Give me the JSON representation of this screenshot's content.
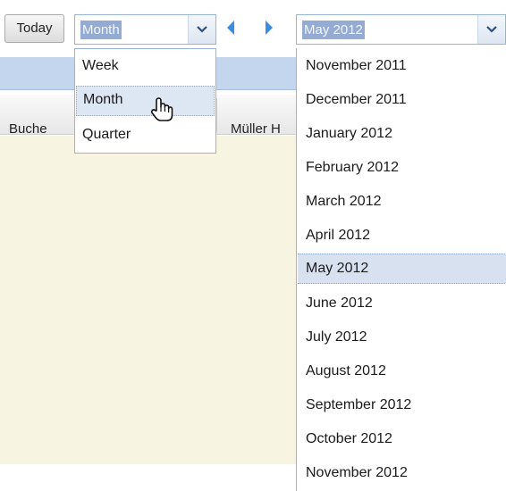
{
  "toolbar": {
    "today_label": "Today",
    "view_select_value": "Month",
    "period_select_value": "May 2012",
    "icons": {
      "prev": "triangle-left-icon",
      "next": "triangle-right-icon",
      "dropdown": "chevron-down-icon"
    }
  },
  "view_menu": {
    "items": [
      "Week",
      "Month",
      "Quarter"
    ],
    "selected": "Month"
  },
  "grid_header": {
    "columns": [
      "Buche",
      "Müller H"
    ]
  },
  "period_menu": {
    "items": [
      "November 2011",
      "December 2011",
      "January 2012",
      "February 2012",
      "March 2012",
      "April 2012",
      "May 2012",
      "June 2012",
      "July 2012",
      "August 2012",
      "September 2012",
      "October 2012",
      "November 2012"
    ],
    "selected": "May 2012"
  },
  "colors": {
    "accent": "#94acd3",
    "selected_row": "#d7e1ef",
    "band": "#c3d6ee",
    "content_bg": "#f7f4e2",
    "nav_arrow": "#3b8de2"
  }
}
